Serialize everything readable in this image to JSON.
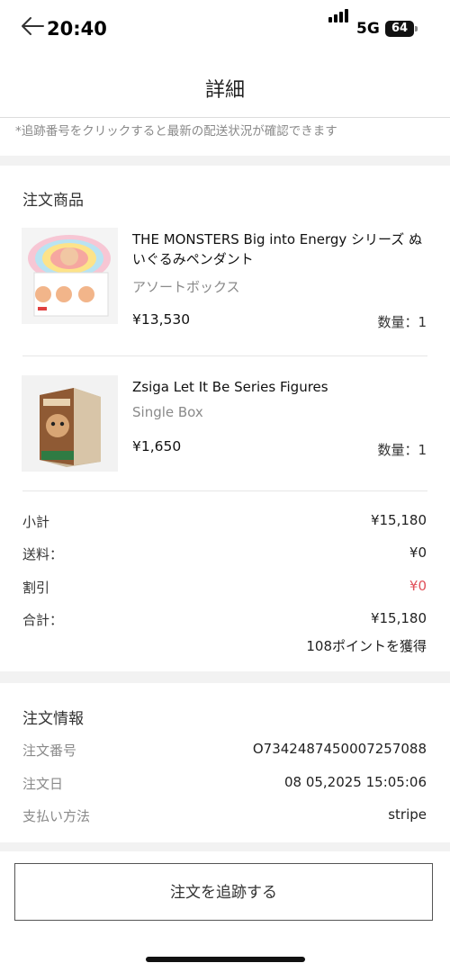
{
  "status_bar": {
    "time": "20:40",
    "network": "5G",
    "battery": "64"
  },
  "header": {
    "title": "詳細"
  },
  "notice": "*追跡番号をクリックすると最新の配送状況が確認できます",
  "items_section": {
    "title": "注文商品",
    "products": [
      {
        "name": "THE MONSTERS Big into Energy シリーズ ぬいぐるみペンダント",
        "variant": "アソートボックス",
        "price": "¥13,530",
        "quantity": "数量：1"
      },
      {
        "name": "Zsiga Let It Be Series Figures",
        "variant": "Single Box",
        "price": "¥1,650",
        "quantity": "数量：1"
      }
    ]
  },
  "summary": {
    "subtotal_label": "小計",
    "subtotal": "¥15,180",
    "shipping_label": "送料：",
    "shipping": "¥0",
    "discount_label": "割引",
    "discount": "¥0",
    "total_label": "合計：",
    "total": "¥15,180",
    "points": "108ポイントを獲得",
    "discount_color": "#e0505a"
  },
  "order_info": {
    "title": "注文情報",
    "number_label": "注文番号",
    "number": "O7342487450007257088",
    "date_label": "注文日",
    "date": "08 05,2025 15:05:06",
    "payment_label": "支払い方法",
    "payment": "stripe"
  },
  "track_button": "注文を追跡する"
}
